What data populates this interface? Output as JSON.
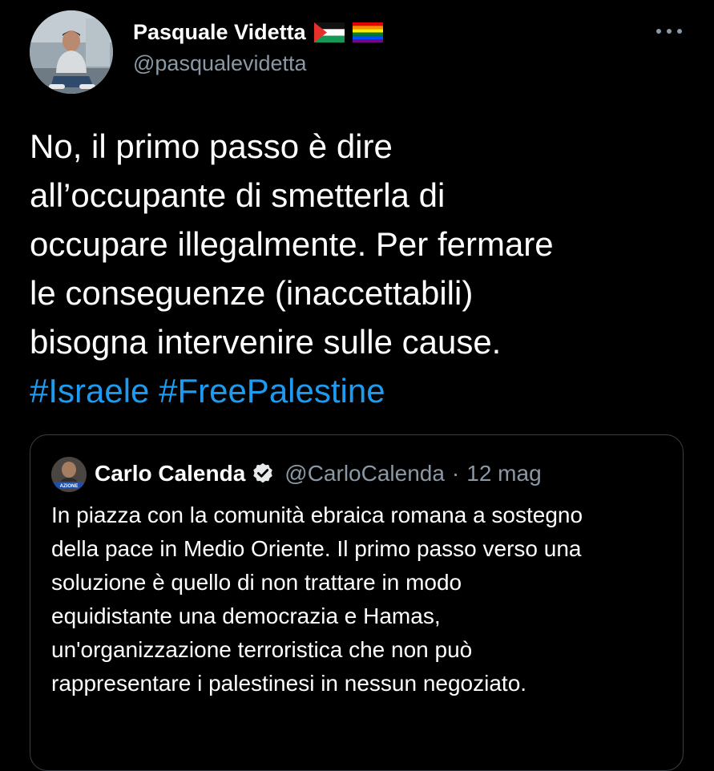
{
  "author": {
    "display_name": "Pasquale Videtta",
    "handle": "@pasqualevidetta",
    "flags": [
      "palestine-flag-icon",
      "rainbow-flag-icon"
    ]
  },
  "tweet": {
    "text_lines": [
      "No, il primo passo è dire",
      "all’occupante di smetterla di",
      "occupare illegalmente. Per fermare",
      "le conseguenze (inaccettabili)",
      "bisogna intervenire sulle cause."
    ],
    "hashtags": [
      "#Israele",
      "#FreePalestine"
    ]
  },
  "quoted_tweet": {
    "display_name": "Carlo Calenda",
    "verified": true,
    "handle": "@CarloCalenda",
    "separator": "·",
    "date": "12 mag",
    "text_lines": [
      "In piazza con la comunità ebraica romana a sostegno",
      "della pace in Medio Oriente. Il primo passo verso una",
      "soluzione è quello di non trattare in modo",
      "equidistante una democrazia e Hamas,",
      "un'organizzazione terroristica che non può",
      "rappresentare i palestinesi in nessun negoziato."
    ],
    "avatar_badge_text": "AZIONE"
  },
  "colors": {
    "background": "#000000",
    "primary_text": "#ffffff",
    "secondary_text": "#8b98a5",
    "link": "#1d9bf0",
    "border": "#3a3f44"
  },
  "icons": {
    "more": "more-options-icon",
    "verified": "verified-badge-icon"
  }
}
